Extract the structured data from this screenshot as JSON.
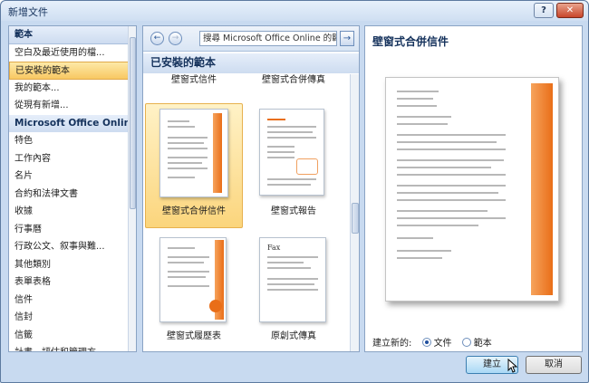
{
  "window": {
    "title": "新增文件",
    "help_label": "?",
    "close_label": "✕"
  },
  "left_panel": {
    "items": [
      {
        "label": "範本",
        "kind": "header"
      },
      {
        "label": "空白及最近使用的檔...",
        "kind": "item"
      },
      {
        "label": "已安裝的範本",
        "kind": "selected"
      },
      {
        "label": "我的範本...",
        "kind": "item"
      },
      {
        "label": "從現有新增...",
        "kind": "item"
      },
      {
        "label": "Microsoft Office Online",
        "kind": "section"
      },
      {
        "label": "特色",
        "kind": "item"
      },
      {
        "label": "工作內容",
        "kind": "item"
      },
      {
        "label": "名片",
        "kind": "item"
      },
      {
        "label": "合約和法律文書",
        "kind": "item"
      },
      {
        "label": "收據",
        "kind": "item"
      },
      {
        "label": "行事曆",
        "kind": "item"
      },
      {
        "label": "行政公文、叙事與難...",
        "kind": "item"
      },
      {
        "label": "其他類別",
        "kind": "item"
      },
      {
        "label": "表單表格",
        "kind": "item"
      },
      {
        "label": "信件",
        "kind": "item"
      },
      {
        "label": "信封",
        "kind": "item"
      },
      {
        "label": "信籤",
        "kind": "item"
      },
      {
        "label": "計畫、評估和管理方...",
        "kind": "item"
      }
    ]
  },
  "center_panel": {
    "back_label": "←",
    "forward_label": "→",
    "search_placeholder": "搜尋 Microsoft Office Online 的範本",
    "go_label": "→",
    "section_title": "已安裝的範本",
    "partial_labels": [
      "壁窗式信件",
      "壁窗式合併傳真"
    ],
    "templates": [
      {
        "label": "壁窗式合併信件",
        "selected": true
      },
      {
        "label": "壁窗式報告",
        "selected": false
      },
      {
        "label": "壁窗式履歷表",
        "selected": false
      },
      {
        "label": "原創式傳真",
        "selected": false
      }
    ],
    "fax_title": "Fax"
  },
  "right_panel": {
    "preview_title": "壁窗式合併信件",
    "create_new_label": "建立新的:",
    "option_document": "文件",
    "option_template": "範本",
    "selected_option": "文件"
  },
  "buttons": {
    "create": "建立",
    "cancel": "取消"
  },
  "colors": {
    "accent_orange": "#e96e18",
    "selection_yellow": "#fbd57c",
    "header_blue": "#15325c"
  }
}
